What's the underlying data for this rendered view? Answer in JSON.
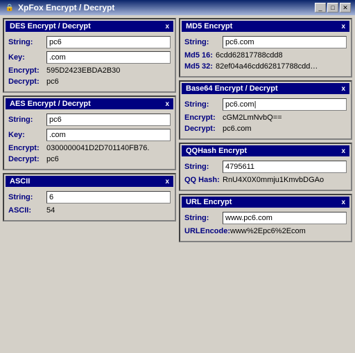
{
  "titleBar": {
    "icon": "🔒",
    "title": "XpFox Encrypt / Decrypt",
    "minBtn": "_",
    "maxBtn": "□",
    "closeBtn": "✕"
  },
  "panels": {
    "des": {
      "header": "DES  Encrypt / Decrypt",
      "closeLabel": "x",
      "fields": [
        {
          "label": "String:",
          "value": "pc6",
          "type": "input"
        },
        {
          "label": "Key:",
          "value": ".com",
          "type": "input"
        },
        {
          "label": "Encrypt:",
          "value": "595D2423EBDA2B30",
          "type": "text"
        },
        {
          "label": "Decrypt:",
          "value": "pc6",
          "type": "text"
        }
      ]
    },
    "aes": {
      "header": "AES  Encrypt / Decrypt",
      "closeLabel": "x",
      "fields": [
        {
          "label": "String:",
          "value": "pc6",
          "type": "input"
        },
        {
          "label": "Key:",
          "value": ".com",
          "type": "input"
        },
        {
          "label": "Encrypt:",
          "value": "0300000041D2D701140FB76.",
          "type": "text"
        },
        {
          "label": "Decrypt:",
          "value": "pc6",
          "type": "text"
        }
      ]
    },
    "ascii": {
      "header": "ASCII",
      "closeLabel": "x",
      "fields": [
        {
          "label": "String:",
          "value": "6",
          "type": "input"
        },
        {
          "label": "ASCII:",
          "value": "54",
          "type": "text"
        }
      ]
    },
    "md5": {
      "header": "MD5 Encrypt",
      "closeLabel": "x",
      "fields": [
        {
          "label": "String:",
          "value": "pc6.com",
          "type": "input"
        },
        {
          "label": "Md5 16:",
          "value": "6cdd62817788cdd8",
          "type": "text"
        },
        {
          "label": "Md5 32:",
          "value": "82ef04a46cdd62817788cdd…",
          "type": "text"
        }
      ]
    },
    "base64": {
      "header": "Base64  Encrypt / Decrypt",
      "closeLabel": "x",
      "fields": [
        {
          "label": "String:",
          "value": "pc6.com|",
          "type": "input"
        },
        {
          "label": "Encrypt:",
          "value": "cGM2LmNvbQ==",
          "type": "text"
        },
        {
          "label": "Decrypt:",
          "value": "pc6.com",
          "type": "text"
        }
      ]
    },
    "qqhash": {
      "header": "QQHash Encrypt",
      "closeLabel": "x",
      "fields": [
        {
          "label": "String:",
          "value": "4795611",
          "type": "input"
        },
        {
          "label": "QQ Hash:",
          "value": "RnU4X0X0mmju1KmvbDGAo",
          "type": "text"
        }
      ]
    },
    "url": {
      "header": "URL Encrypt",
      "closeLabel": "x",
      "fields": [
        {
          "label": "String:",
          "value": "www.pc6.com",
          "type": "input"
        },
        {
          "label": "URLEncode:",
          "value": "www%2Epc6%2Ecom",
          "type": "text"
        }
      ]
    }
  }
}
